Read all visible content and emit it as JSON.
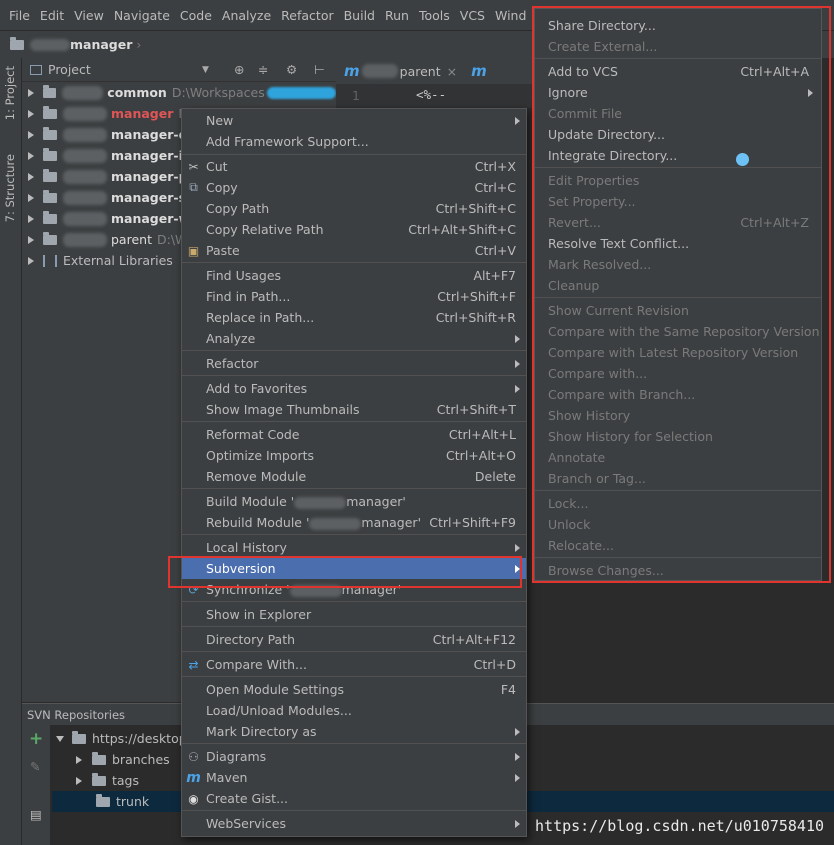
{
  "menubar": {
    "items": [
      "File",
      "Edit",
      "View",
      "Navigate",
      "Code",
      "Analyze",
      "Refactor",
      "Build",
      "Run",
      "Tools",
      "VCS",
      "Wind"
    ]
  },
  "breadcrumb": {
    "module": "manager"
  },
  "toolstrip": {
    "project_tab": "1: Project",
    "structure_tab": "7: Structure"
  },
  "project": {
    "header": "Project",
    "rows": [
      {
        "name": "common",
        "path": "D:\\Workspaces"
      },
      {
        "name": "manager",
        "path": "D:"
      },
      {
        "name": "manager-da",
        "path": ""
      },
      {
        "name": "manager-int",
        "path": ""
      },
      {
        "name": "manager-po",
        "path": ""
      },
      {
        "name": "manager-se",
        "path": ""
      },
      {
        "name": "manager-we",
        "path": ""
      },
      {
        "name": "parent",
        "path": "D:\\W"
      }
    ],
    "external": "External Libraries"
  },
  "editor": {
    "tab1": "parent",
    "tab2": "m",
    "line_number": "1",
    "code": "<%--"
  },
  "context_menu": {
    "new": "New",
    "add_framework": "Add Framework Support...",
    "cut": "Cut",
    "cut_sc": "Ctrl+X",
    "copy": "Copy",
    "copy_sc": "Ctrl+C",
    "copy_path": "Copy Path",
    "copy_path_sc": "Ctrl+Shift+C",
    "copy_rel": "Copy Relative Path",
    "copy_rel_sc": "Ctrl+Alt+Shift+C",
    "paste": "Paste",
    "paste_sc": "Ctrl+V",
    "find_usages": "Find Usages",
    "find_usages_sc": "Alt+F7",
    "find_in_path": "Find in Path...",
    "find_in_path_sc": "Ctrl+Shift+F",
    "replace_in_path": "Replace in Path...",
    "replace_in_path_sc": "Ctrl+Shift+R",
    "analyze": "Analyze",
    "refactor": "Refactor",
    "add_fav": "Add to Favorites",
    "show_thumbs": "Show Image Thumbnails",
    "show_thumbs_sc": "Ctrl+Shift+T",
    "reformat": "Reformat Code",
    "reformat_sc": "Ctrl+Alt+L",
    "optimize": "Optimize Imports",
    "optimize_sc": "Ctrl+Alt+O",
    "remove_module": "Remove Module",
    "remove_module_sc": "Delete",
    "build_module": "Build Module '",
    "build_module_tail": "manager'",
    "rebuild_module": "Rebuild Module '",
    "rebuild_module_tail": "manager'",
    "rebuild_sc": "Ctrl+Shift+F9",
    "local_history": "Local History",
    "subversion": "Subversion",
    "synchronize": "Synchronize '",
    "synchronize_tail": "manager'",
    "show_explorer": "Show in Explorer",
    "dir_path": "Directory Path",
    "dir_path_sc": "Ctrl+Alt+F12",
    "compare_with": "Compare With...",
    "compare_with_sc": "Ctrl+D",
    "open_module_settings": "Open Module Settings",
    "open_module_settings_sc": "F4",
    "load_unload": "Load/Unload Modules...",
    "mark_dir": "Mark Directory as",
    "diagrams": "Diagrams",
    "maven": "Maven",
    "create_gist": "Create Gist...",
    "webservices": "WebServices"
  },
  "svn_menu": {
    "share": "Share Directory...",
    "create_external": "Create External...",
    "add_vcs": "Add to VCS",
    "add_vcs_sc": "Ctrl+Alt+A",
    "ignore": "Ignore",
    "commit": "Commit File",
    "update": "Update Directory...",
    "integrate": "Integrate Directory...",
    "edit_props": "Edit Properties",
    "set_prop": "Set Property...",
    "revert": "Revert...",
    "revert_sc": "Ctrl+Alt+Z",
    "resolve": "Resolve Text Conflict...",
    "mark_resolved": "Mark Resolved...",
    "cleanup": "Cleanup",
    "show_rev": "Show Current Revision",
    "cmp_same": "Compare with the Same Repository Version",
    "cmp_latest": "Compare with Latest Repository Version",
    "cmp_with": "Compare with...",
    "cmp_branch": "Compare with Branch...",
    "history": "Show History",
    "history_sel": "Show History for Selection",
    "annotate": "Annotate",
    "branch_tag": "Branch or Tag...",
    "lock": "Lock...",
    "unlock": "Unlock",
    "relocate": "Relocate...",
    "browse": "Browse Changes..."
  },
  "svn_repos": {
    "title": "SVN Repositories",
    "root": "https://desktop",
    "branches": "branches",
    "tags": "tags",
    "trunk": "trunk"
  },
  "watermark": "https://blog.csdn.net/u010758410",
  "colors": {
    "selection": "#4b6eaf",
    "highlight_box": "#e0342e",
    "background": "#3c3f41"
  }
}
